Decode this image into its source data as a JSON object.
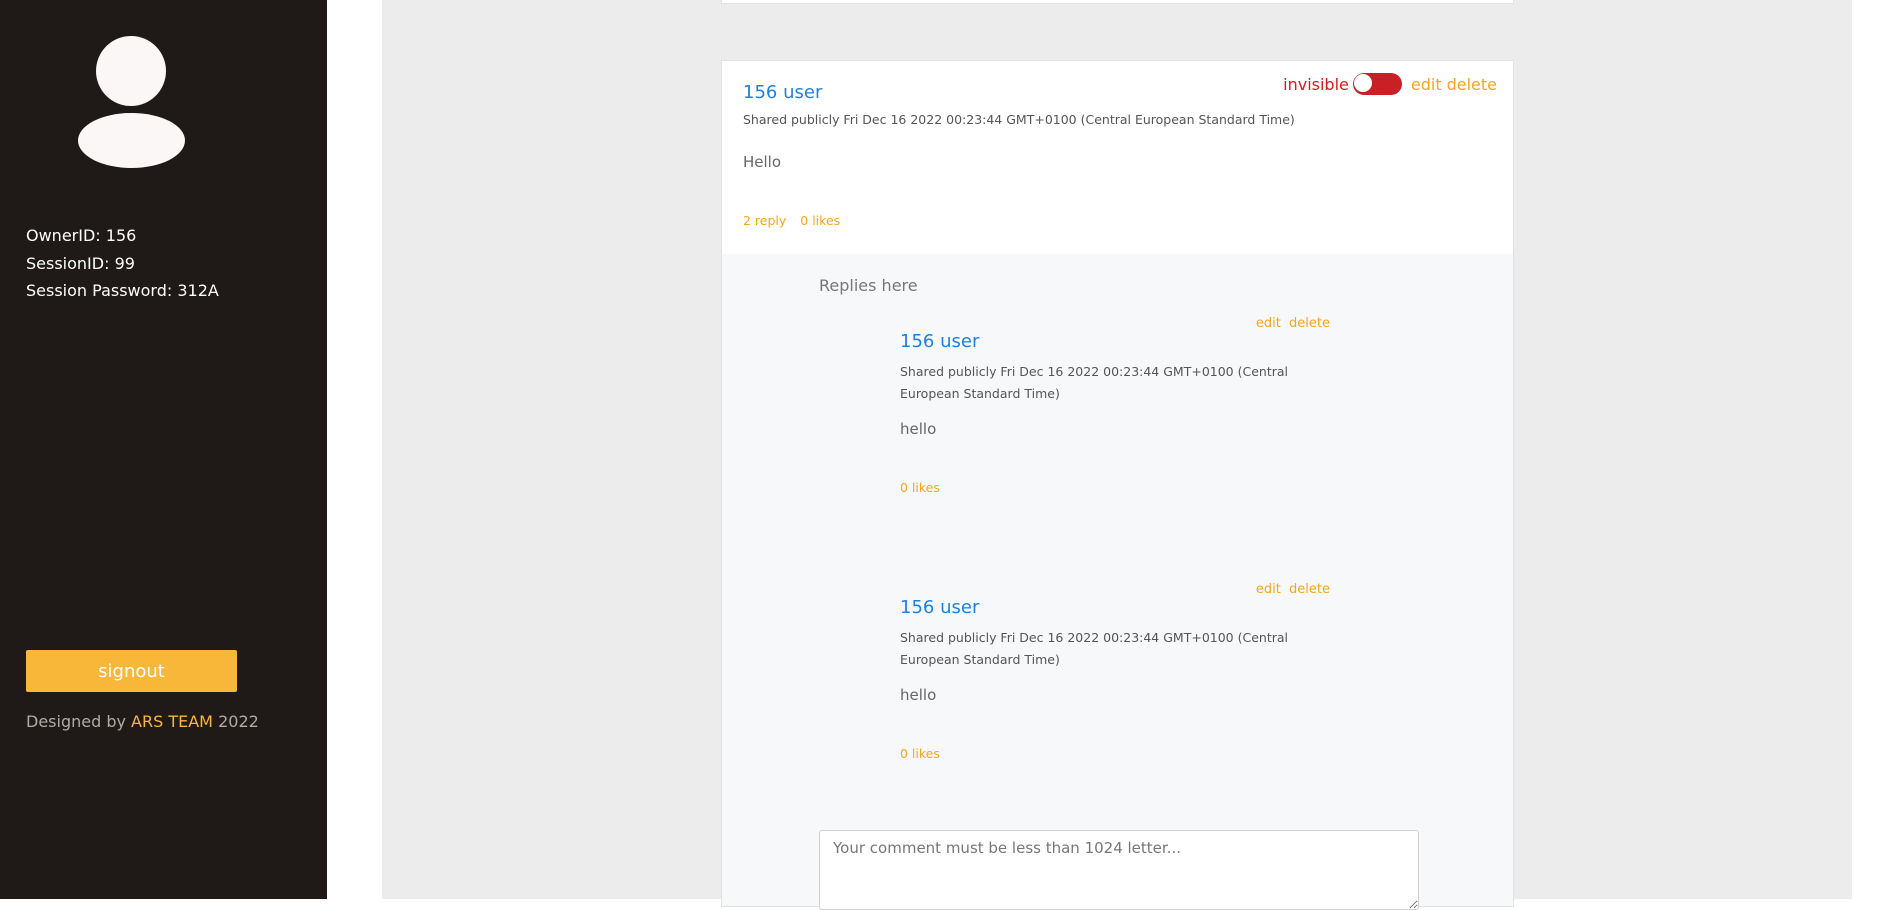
{
  "sidebar": {
    "owner_id": "OwnerID: 156",
    "session_id": "SessionID: 99",
    "session_password": "Session Password: 312A",
    "signout_label": "signout",
    "credit_prefix": "Designed by",
    "credit_team": "ARS TEAM",
    "credit_year": "2022"
  },
  "post": {
    "author": "156 user",
    "meta": "Shared publicly Fri Dec 16 2022 00:23:44 GMT+0100 (Central European Standard Time)",
    "body": "Hello",
    "reply_count": "2 reply",
    "likes": "0 likes",
    "visibility_label": "invisible",
    "edit_label": "edit",
    "delete_label": "delete"
  },
  "replies": {
    "title": "Replies here",
    "items": [
      {
        "edit_label": "edit",
        "delete_label": "delete",
        "author": "156 user",
        "meta": "Shared publicly Fri Dec 16 2022 00:23:44 GMT+0100 (Central European Standard Time)",
        "body": "hello",
        "likes": "0 likes"
      },
      {
        "edit_label": "edit",
        "delete_label": "delete",
        "author": "156 user",
        "meta": "Shared publicly Fri Dec 16 2022 00:23:44 GMT+0100 (Central European Standard Time)",
        "body": "hello",
        "likes": "0 likes"
      }
    ],
    "comment_placeholder": "Your comment must be less than 1024 letter..."
  },
  "colors": {
    "sidebar_bg": "#1f1a18",
    "accent": "#f8b739",
    "link_blue": "#1a82e2",
    "invisible_red": "#e0161d"
  }
}
